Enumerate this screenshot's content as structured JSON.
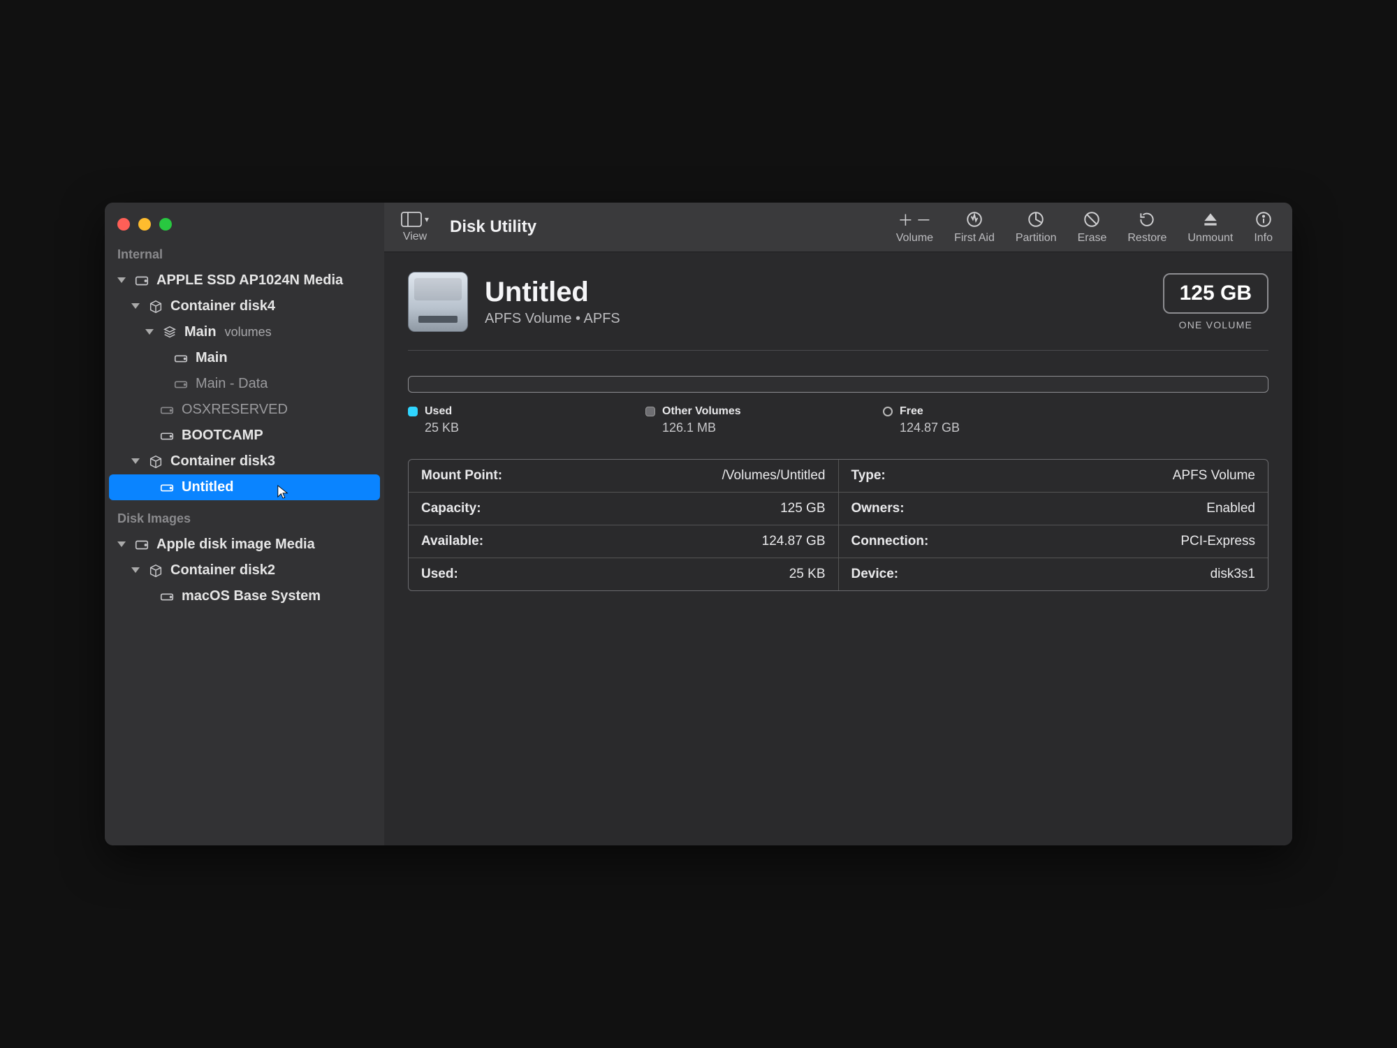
{
  "window": {
    "app_title": "Disk Utility"
  },
  "toolbar": {
    "view_label": "View",
    "volume_label": "Volume",
    "firstaid_label": "First Aid",
    "partition_label": "Partition",
    "erase_label": "Erase",
    "restore_label": "Restore",
    "unmount_label": "Unmount",
    "info_label": "Info"
  },
  "sidebar": {
    "sections": {
      "internal": "Internal",
      "disk_images": "Disk Images"
    },
    "internal_media": "APPLE SSD AP1024N Media",
    "container4": "Container disk4",
    "main_group": {
      "name": "Main",
      "suffix": "volumes"
    },
    "main_vol": "Main",
    "main_data": "Main - Data",
    "osxreserved": "OSXRESERVED",
    "bootcamp": "BOOTCAMP",
    "container3": "Container disk3",
    "untitled": "Untitled",
    "apple_disk_image": "Apple disk image Media",
    "container2": "Container disk2",
    "macos_base": "macOS Base System"
  },
  "volume": {
    "name": "Untitled",
    "subtitle": "APFS Volume • APFS",
    "size": "125 GB",
    "size_caption": "ONE VOLUME"
  },
  "usage": {
    "used_label": "Used",
    "used_value": "25 KB",
    "other_label": "Other Volumes",
    "other_value": "126.1 MB",
    "free_label": "Free",
    "free_value": "124.87 GB"
  },
  "details": {
    "mount_point": {
      "key": "Mount Point:",
      "val": "/Volumes/Untitled"
    },
    "capacity": {
      "key": "Capacity:",
      "val": "125 GB"
    },
    "available": {
      "key": "Available:",
      "val": "124.87 GB"
    },
    "used": {
      "key": "Used:",
      "val": "25 KB"
    },
    "type": {
      "key": "Type:",
      "val": "APFS Volume"
    },
    "owners": {
      "key": "Owners:",
      "val": "Enabled"
    },
    "connection": {
      "key": "Connection:",
      "val": "PCI-Express"
    },
    "device": {
      "key": "Device:",
      "val": "disk3s1"
    }
  }
}
